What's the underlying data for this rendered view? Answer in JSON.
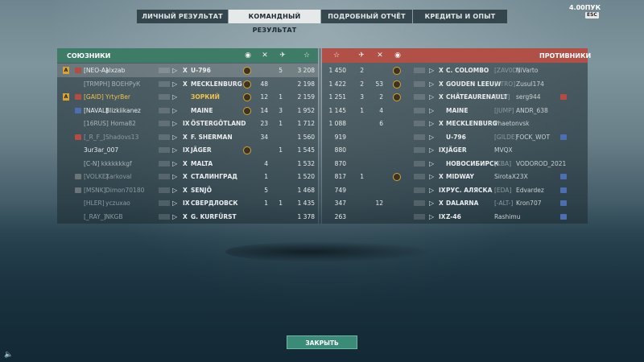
{
  "tabs": [
    {
      "label": "ЛИЧНЫЙ РЕЗУЛЬТАТ",
      "active": false
    },
    {
      "label": "КОМАНДНЫЙ РЕЗУЛЬТАТ",
      "active": true
    },
    {
      "label": "ПОДРОБНЫЙ ОТЧЁТ",
      "active": false
    },
    {
      "label": "КРЕДИТЫ И ОПЫТ",
      "active": false
    }
  ],
  "points": "4.00ПУК",
  "esc_label": "ESC",
  "allies": {
    "title": "СОЮЗНИКИ",
    "icons": [
      "medal-icon",
      "kills-icon",
      "planes-icon",
      "star-icon"
    ],
    "players": [
      {
        "clan": "[NEO-A]",
        "name": "alxzab",
        "tier": "X",
        "ship": "U-796",
        "medal": true,
        "kills": "",
        "planes": "5",
        "exp": "3 208",
        "highlight": true,
        "badge": "A",
        "rank": "red",
        "dim": false
      },
      {
        "clan": "",
        "name": "[TRMPH] ВОЕНРуК",
        "tier": "X",
        "ship": "MECKLENBURG",
        "medal": true,
        "kills": "48",
        "planes": "",
        "exp": "2 198",
        "highlight": false,
        "badge": "",
        "rank": "",
        "dim": true
      },
      {
        "clan": "[GAID]",
        "name": "YrtyrBer",
        "tier": "",
        "ship": "ЗОРКИЙ",
        "medal": true,
        "kills": "12",
        "planes": "1",
        "exp": "2 159",
        "highlight": false,
        "badge": "A",
        "rank": "red",
        "dim": false,
        "gold": true
      },
      {
        "clan": "[NAVAL]",
        "name": "Blizkiikanez",
        "tier": "",
        "ship": "MAINE",
        "medal": true,
        "kills": "14",
        "planes": "3",
        "exp": "1 952",
        "highlight": false,
        "badge": "",
        "rank": "blue",
        "dim": false
      },
      {
        "clan": "",
        "name": "[16RUS] Homa82",
        "tier": "IX",
        "ship": "ÖSTERGÖTLAND",
        "medal": false,
        "kills": "23",
        "planes": "1",
        "exp": "1 712",
        "highlight": false,
        "badge": "",
        "rank": "",
        "dim": true
      },
      {
        "clan": "[_R_F_]",
        "name": "Shadovs13",
        "tier": "X",
        "ship": "F. SHERMAN",
        "medal": false,
        "kills": "34",
        "planes": "",
        "exp": "1 560",
        "highlight": false,
        "badge": "",
        "rank": "red",
        "dim": true
      },
      {
        "clan": "",
        "name": "3ur3ar_007",
        "tier": "IX",
        "ship": "JÄGER",
        "medal": true,
        "kills": "",
        "planes": "1",
        "exp": "1 545",
        "highlight": false,
        "badge": "",
        "rank": "",
        "dim": false
      },
      {
        "clan": "",
        "name": "[C-N] kkkkkkkgf",
        "tier": "X",
        "ship": "MALTA",
        "medal": false,
        "kills": "4",
        "planes": "",
        "exp": "1 532",
        "highlight": false,
        "badge": "",
        "rank": "",
        "dim": true
      },
      {
        "clan": "[VOLKE]",
        "name": "Xarkoval",
        "tier": "X",
        "ship": "СТАЛИНГРАД",
        "medal": false,
        "kills": "1",
        "planes": "",
        "exp": "1 520",
        "highlight": false,
        "badge": "",
        "rank": "grey",
        "dim": true
      },
      {
        "clan": "[MSNK]",
        "name": "Dimon70180",
        "tier": "X",
        "ship": "SENJŌ",
        "medal": false,
        "kills": "5",
        "planes": "",
        "exp": "1 468",
        "highlight": false,
        "badge": "",
        "rank": "grey",
        "dim": true
      },
      {
        "clan": "[HLER]",
        "name": "yczuxao",
        "tier": "IX",
        "ship": "СВЕРДЛОВСК",
        "medal": false,
        "kills": "1",
        "planes": "1",
        "exp": "1 435",
        "highlight": false,
        "badge": "",
        "rank": "",
        "dim": true
      },
      {
        "clan": "[_RAY_]",
        "name": "NKGB",
        "tier": "X",
        "ship": "G. KURFÜRST",
        "medal": false,
        "kills": "",
        "planes": "",
        "exp": "1 378",
        "highlight": false,
        "badge": "",
        "rank": "",
        "dim": true
      }
    ]
  },
  "enemies": {
    "title": "ПРОТИВНИКИ",
    "icons": [
      "star-icon",
      "planes-icon",
      "kills-icon",
      "medal-icon"
    ],
    "players": [
      {
        "exp": "1 450",
        "planes": "2",
        "kills": "",
        "medal": true,
        "tier": "X",
        "ship": "C. COLOMBO",
        "clan": "[ZAV0D]",
        "name": "NiVarto",
        "rank": ""
      },
      {
        "exp": "1 422",
        "planes": "2",
        "kills": "53",
        "medal": true,
        "tier": "X",
        "ship": "GOUDEN LEEUW",
        "clan": "[YTRO]",
        "name": "Zusul174",
        "rank": ""
      },
      {
        "exp": "1 251",
        "planes": "3",
        "kills": "2",
        "medal": true,
        "tier": "X",
        "ship": "CHÂTEAURENAULT",
        "clan": "[C-N]",
        "name": "serg944",
        "rank": "red"
      },
      {
        "exp": "1 145",
        "planes": "1",
        "kills": "4",
        "medal": false,
        "tier": "",
        "ship": "MAINE",
        "clan": "[JUMP]",
        "name": "ANDR_638",
        "rank": ""
      },
      {
        "exp": "1 088",
        "planes": "",
        "kills": "6",
        "medal": false,
        "tier": "X",
        "ship": "MECKLENBURG",
        "clan": "",
        "name": "Phaetonvsk",
        "rank": ""
      },
      {
        "exp": "919",
        "planes": "",
        "kills": "",
        "medal": false,
        "tier": "",
        "ship": "U-796",
        "clan": "[GILDE]",
        "name": "FOCK_WOT",
        "rank": "blue"
      },
      {
        "exp": "880",
        "planes": "",
        "kills": "",
        "medal": false,
        "tier": "IX",
        "ship": "JÄGER",
        "clan": "",
        "name": "MVQX",
        "rank": ""
      },
      {
        "exp": "870",
        "planes": "",
        "kills": "",
        "medal": false,
        "tier": "",
        "ship": "НОВОСИБИРСК",
        "clan": "[KBA]",
        "name": "VODOROD_2021",
        "rank": ""
      },
      {
        "exp": "817",
        "planes": "1",
        "kills": "",
        "medal": true,
        "tier": "X",
        "ship": "MIDWAY",
        "clan": "",
        "name": "SirotaX23X",
        "rank": "blue"
      },
      {
        "exp": "749",
        "planes": "",
        "kills": "",
        "medal": false,
        "tier": "IX",
        "ship": "РУС. АЛЯСКА",
        "clan": "[EDA]",
        "name": "Edvardez",
        "rank": "blue"
      },
      {
        "exp": "347",
        "planes": "",
        "kills": "12",
        "medal": false,
        "tier": "X",
        "ship": "DALARNA",
        "clan": "[-ALT-]",
        "name": "Kron707",
        "rank": "blue"
      },
      {
        "exp": "263",
        "planes": "",
        "kills": "",
        "medal": false,
        "tier": "IX",
        "ship": "Z-46",
        "clan": "",
        "name": "Rashimu",
        "rank": "blue"
      }
    ]
  },
  "close_label": "ЗАКРЫТЬ"
}
